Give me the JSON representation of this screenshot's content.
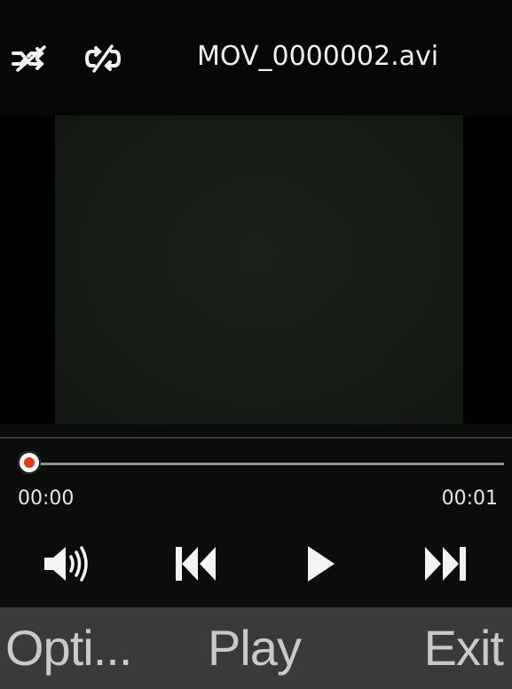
{
  "header": {
    "file_name": "MOV_0000002.avi",
    "shuffle_icon": "shuffle-off-icon",
    "repeat_icon": "repeat-off-icon"
  },
  "playback": {
    "current_time": "00:00",
    "total_time": "00:01",
    "progress_fraction": 0,
    "progress_knob_color": "#e23a1a"
  },
  "controls": {
    "volume_icon": "volume-icon",
    "previous_icon": "previous-track-icon",
    "play_icon": "play-icon",
    "next_icon": "next-track-icon"
  },
  "softkeys": {
    "left": "Opti...",
    "center": "Play",
    "right": "Exit"
  }
}
